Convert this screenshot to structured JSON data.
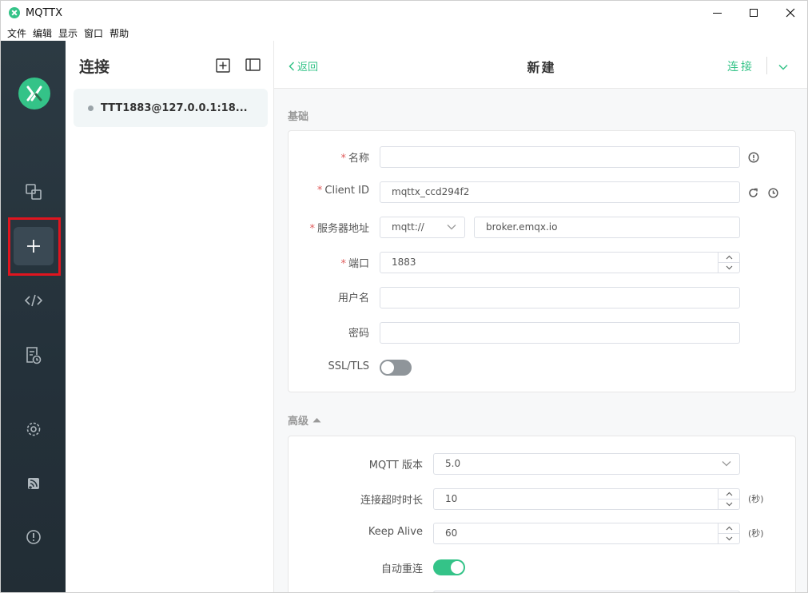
{
  "window": {
    "title": "MQTTX"
  },
  "menu": [
    "文件",
    "编辑",
    "显示",
    "窗口",
    "帮助"
  ],
  "rail": {
    "items": [
      "connections-icon",
      "new-connection-icon",
      "script-icon",
      "log-icon",
      "settings-icon",
      "subscribe-icon",
      "about-icon"
    ],
    "active": "new-connection-icon"
  },
  "connections": {
    "title": "连接",
    "items": [
      {
        "label": "TTT1883@127.0.0.1:18..."
      }
    ]
  },
  "topbar": {
    "back_label": "返回",
    "title": "新建",
    "connect_label": "连接"
  },
  "basic": {
    "section_label": "基础",
    "name_label": "名称",
    "name_value": "",
    "client_id_label": "Client ID",
    "client_id_value": "mqttx_ccd294f2",
    "host_label": "服务器地址",
    "protocol_value": "mqtt://",
    "host_value": "broker.emqx.io",
    "port_label": "端口",
    "port_value": "1883",
    "username_label": "用户名",
    "username_value": "",
    "password_label": "密码",
    "password_value": "",
    "ssl_label": "SSL/TLS",
    "ssl_enabled": false
  },
  "advanced": {
    "section_label": "高级",
    "mqtt_version_label": "MQTT 版本",
    "mqtt_version_value": "5.0",
    "timeout_label": "连接超时时长",
    "timeout_value": "10",
    "timeout_unit": "(秒)",
    "keepalive_label": "Keep Alive",
    "keepalive_value": "60",
    "keepalive_unit": "(秒)",
    "reconnect_label": "自动重连",
    "reconnect_enabled": true
  },
  "colors": {
    "accent": "#34c388",
    "rail_bg": "#2c3a43",
    "required": "#e05c5c",
    "annotation": "#e0151f"
  }
}
